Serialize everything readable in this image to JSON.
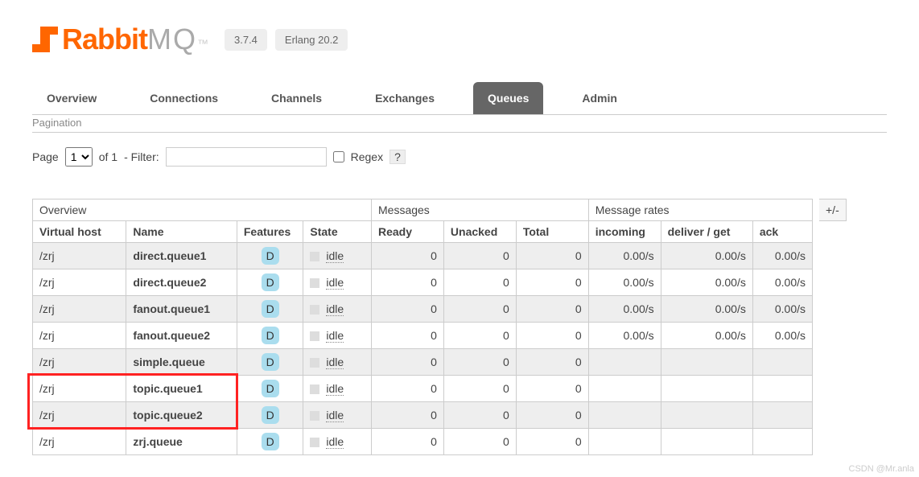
{
  "logo": {
    "text1": "Rabbit",
    "text2": "MQ",
    "tm": "™"
  },
  "version_badge": "3.7.4",
  "erlang_badge": "Erlang 20.2",
  "nav": [
    "Overview",
    "Connections",
    "Channels",
    "Exchanges",
    "Queues",
    "Admin"
  ],
  "active_tab": "Queues",
  "pagination_title": "Pagination",
  "filter": {
    "page_label": "Page",
    "page_select": "1",
    "of_text": "of 1",
    "filter_label": "- Filter:",
    "filter_value": "",
    "regex_label": "Regex",
    "help": "?"
  },
  "plusminus": "+/-",
  "headers": {
    "group_overview": "Overview",
    "group_messages": "Messages",
    "group_rates": "Message rates",
    "vhost": "Virtual host",
    "name": "Name",
    "features": "Features",
    "state": "State",
    "ready": "Ready",
    "unacked": "Unacked",
    "total": "Total",
    "incoming": "incoming",
    "deliver": "deliver / get",
    "ack": "ack"
  },
  "feature_d": "D",
  "state_idle": "idle",
  "rows": [
    {
      "vhost": "/zrj",
      "name": "direct.queue1",
      "ready": "0",
      "unacked": "0",
      "total": "0",
      "incoming": "0.00/s",
      "deliver": "0.00/s",
      "ack": "0.00/s"
    },
    {
      "vhost": "/zrj",
      "name": "direct.queue2",
      "ready": "0",
      "unacked": "0",
      "total": "0",
      "incoming": "0.00/s",
      "deliver": "0.00/s",
      "ack": "0.00/s"
    },
    {
      "vhost": "/zrj",
      "name": "fanout.queue1",
      "ready": "0",
      "unacked": "0",
      "total": "0",
      "incoming": "0.00/s",
      "deliver": "0.00/s",
      "ack": "0.00/s"
    },
    {
      "vhost": "/zrj",
      "name": "fanout.queue2",
      "ready": "0",
      "unacked": "0",
      "total": "0",
      "incoming": "0.00/s",
      "deliver": "0.00/s",
      "ack": "0.00/s"
    },
    {
      "vhost": "/zrj",
      "name": "simple.queue",
      "ready": "0",
      "unacked": "0",
      "total": "0",
      "incoming": "",
      "deliver": "",
      "ack": ""
    },
    {
      "vhost": "/zrj",
      "name": "topic.queue1",
      "ready": "0",
      "unacked": "0",
      "total": "0",
      "incoming": "",
      "deliver": "",
      "ack": ""
    },
    {
      "vhost": "/zrj",
      "name": "topic.queue2",
      "ready": "0",
      "unacked": "0",
      "total": "0",
      "incoming": "",
      "deliver": "",
      "ack": ""
    },
    {
      "vhost": "/zrj",
      "name": "zrj.queue",
      "ready": "0",
      "unacked": "0",
      "total": "0",
      "incoming": "",
      "deliver": "",
      "ack": ""
    }
  ],
  "watermark": "CSDN @Mr.anla"
}
